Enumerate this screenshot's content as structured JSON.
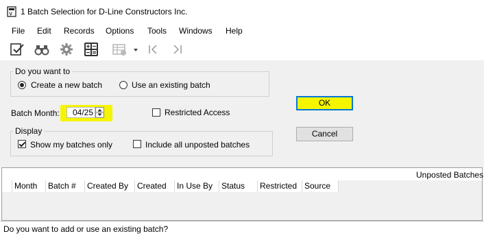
{
  "window": {
    "title": "1 Batch Selection for D-Line Constructors Inc."
  },
  "menu": {
    "items": [
      "File",
      "Edit",
      "Records",
      "Options",
      "Tools",
      "Windows",
      "Help"
    ]
  },
  "toolbar": {
    "icons": [
      "checklist-icon",
      "binoculars-icon",
      "gear-icon",
      "calculator-icon",
      "grid-settings-icon",
      "dropdown-arrow-icon",
      "first-record-icon",
      "next-record-icon"
    ]
  },
  "batch_choice": {
    "legend": "Do you want to",
    "option_new": "Create a new batch",
    "option_existing": "Use an existing batch",
    "selected": "Create a new batch"
  },
  "batch_month": {
    "label": "Batch Month:",
    "value": "04/25"
  },
  "restricted_access": {
    "label": "Restricted Access",
    "checked": false
  },
  "display": {
    "legend": "Display",
    "show_my_batches": "Show my batches only",
    "show_my_batches_checked": true,
    "include_unposted": "Include all unposted batches",
    "include_unposted_checked": false
  },
  "buttons": {
    "ok": "OK",
    "cancel": "Cancel"
  },
  "grid": {
    "caption": "Unposted Batches",
    "columns": [
      "Month",
      "Batch #",
      "Created By",
      "Created",
      "In Use By",
      "Status",
      "Restricted",
      "Source"
    ]
  },
  "status": {
    "text": "Do you want to add or use an existing batch?"
  },
  "colors": {
    "highlight": "#f5f500",
    "focus_border": "#0078d7",
    "panel": "#f0f0f0"
  }
}
